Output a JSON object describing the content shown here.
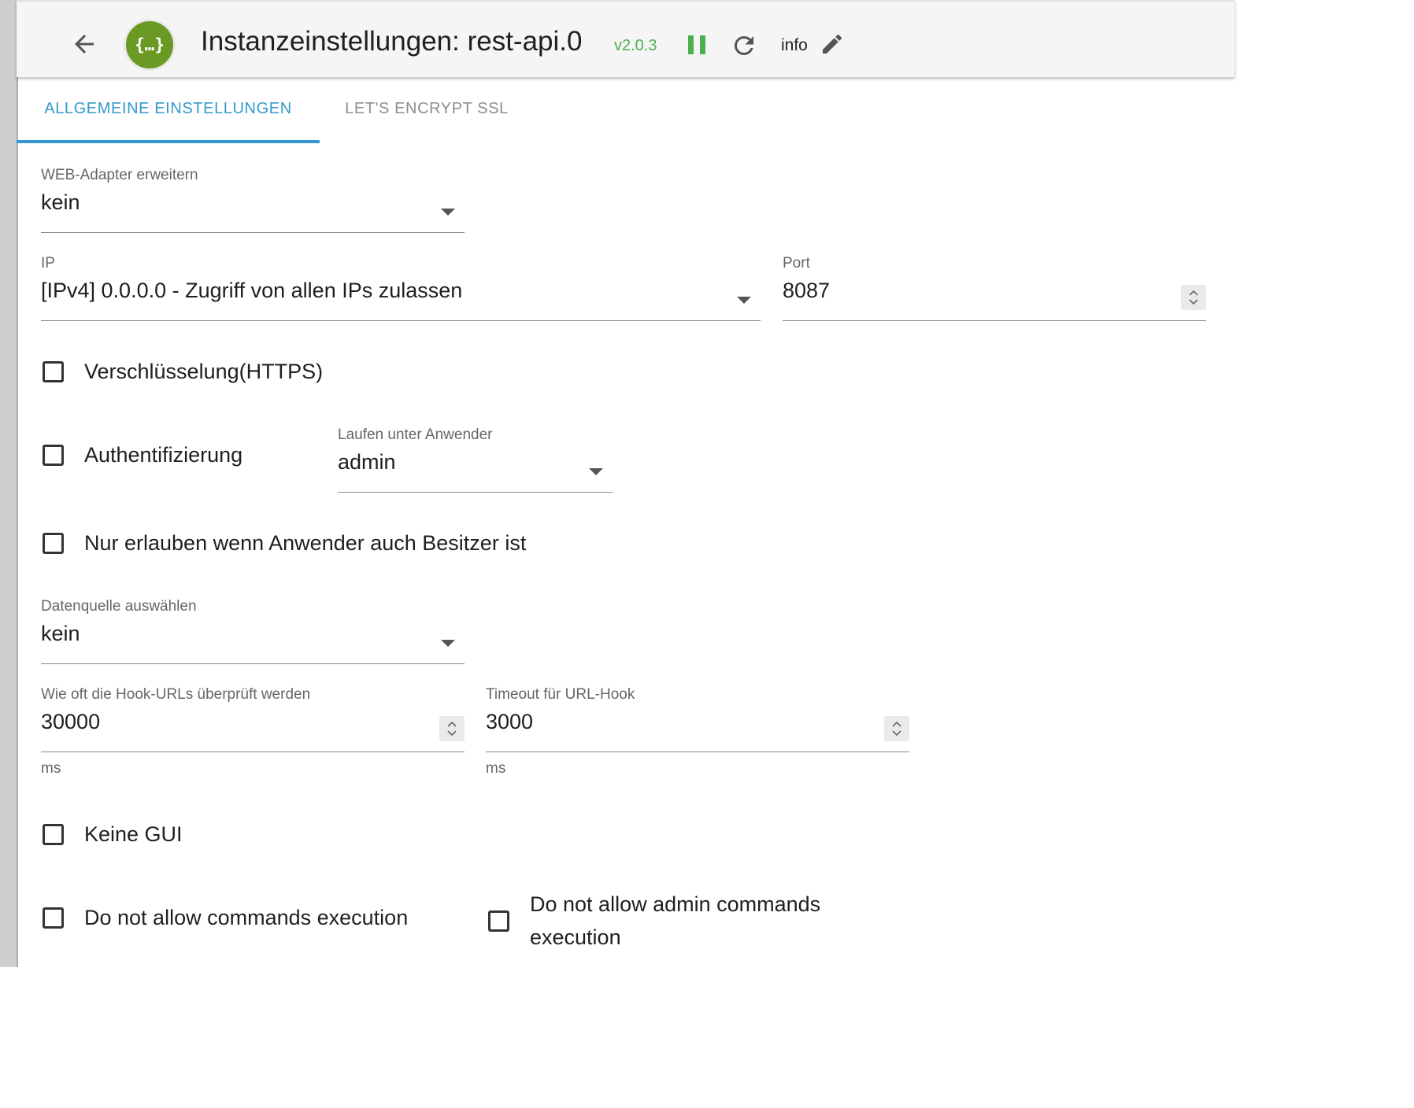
{
  "header": {
    "logo_text": "{…}",
    "title": "Instanzeinstellungen: rest-api.0",
    "version": "v2.0.3",
    "info_label": "info",
    "icons": [
      "arrow-left-icon",
      "pause-icon",
      "reload-icon",
      "pencil-icon"
    ],
    "colors": {
      "version": "#4caf50",
      "pause": "#4caf50",
      "logo": "#6a9a23"
    }
  },
  "tabs": [
    {
      "label": "ALLGEMEINE EINSTELLUNGEN",
      "active": true
    },
    {
      "label": "LET'S ENCRYPT SSL",
      "active": false
    }
  ],
  "accent_color": "#3399cc",
  "form": {
    "web_adapter": {
      "label": "WEB-Adapter erweitern",
      "value": "kein"
    },
    "ip": {
      "label": "IP",
      "value": "[IPv4] 0.0.0.0 - Zugriff von allen IPs zulassen"
    },
    "port": {
      "label": "Port",
      "value": "8087"
    },
    "https": {
      "label": "Verschlüsselung(HTTPS)",
      "checked": false
    },
    "auth": {
      "label": "Authentifizierung",
      "checked": false
    },
    "run_as": {
      "label": "Laufen unter Anwender",
      "value": "admin"
    },
    "owner_only": {
      "label": "Nur erlauben wenn Anwender auch Besitzer ist",
      "checked": false
    },
    "datasource": {
      "label": "Datenquelle auswählen",
      "value": "kein"
    },
    "hook_interval": {
      "label": "Wie oft die Hook-URLs überprüft werden",
      "value": "30000",
      "unit": "ms"
    },
    "hook_timeout": {
      "label": "Timeout für URL-Hook",
      "value": "3000",
      "unit": "ms"
    },
    "no_gui": {
      "label": "Keine GUI",
      "checked": false
    },
    "no_commands": {
      "label": "Do not allow commands execution",
      "checked": false
    },
    "no_admin_commands": {
      "label": "Do not allow admin commands execution",
      "checked": false
    }
  }
}
